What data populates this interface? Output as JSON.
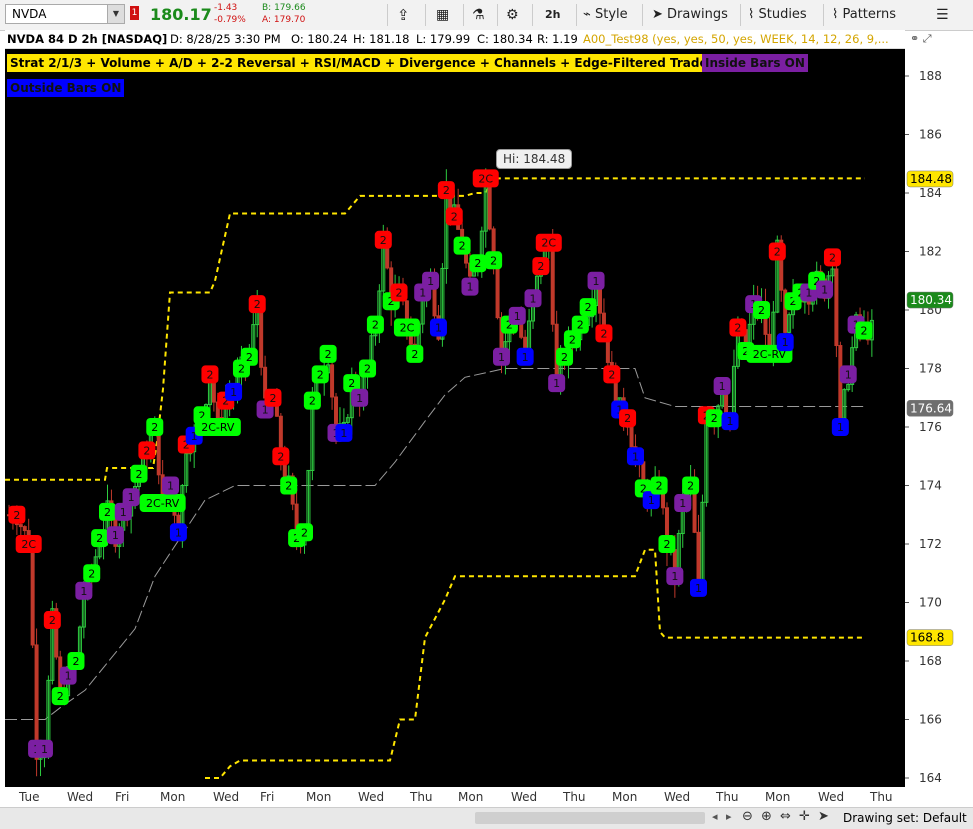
{
  "toolbar": {
    "symbol": "NVDA",
    "flag": "1",
    "last": "180.17",
    "change": "-1.43",
    "change_pct": "-0.79%",
    "bid": "B: 179.66",
    "ask": "A: 179.70",
    "timeframe": "2h",
    "style": "Style",
    "drawings": "Drawings",
    "studies": "Studies",
    "patterns": "Patterns"
  },
  "infobar": {
    "title": "NVDA 84 D 2h [NASDAQ]",
    "date": "D: 8/28/25 3:30 PM",
    "open": "O: 180.24",
    "high": "H: 181.18",
    "low": "L: 179.99",
    "close": "C: 180.34",
    "range": "R: 1.19",
    "study": "A00_Test98 (yes, yes, 50, yes, WEEK, 14, 12, 26, 9,..."
  },
  "labels": {
    "strat": "Strat 2/1/3 + Volume + A/D + 2-2 Reversal + RSI/MACD + Divergence + Channels + Edge-Filtered Trade Bubbles",
    "inside": "Inside Bars ON",
    "outside": "Outside Bars ON",
    "high_bubble": "Hi: 184.48"
  },
  "colors": {
    "up": "#2ecc40",
    "down": "#c0392b",
    "channel": "#ffe600",
    "bubble_green": "#00ff00",
    "bubble_red": "#ff0000",
    "bubble_purple": "#7b1fa2",
    "bubble_blue": "#0000ff"
  },
  "yaxis": {
    "ticks": [
      "188",
      "186",
      "184",
      "182",
      "180",
      "178",
      "176",
      "174",
      "172",
      "170",
      "168",
      "166",
      "164"
    ],
    "tags": [
      {
        "value": 184.48,
        "text": "184.48",
        "kind": "yellow"
      },
      {
        "value": 180.34,
        "text": "180.34",
        "kind": "green"
      },
      {
        "value": 176.64,
        "text": "176.64",
        "kind": "gray"
      },
      {
        "value": 168.8,
        "text": "168.8",
        "kind": "yellow"
      }
    ]
  },
  "xaxis": {
    "labels": [
      "Tue",
      "Wed",
      "Fri",
      "Mon",
      "Wed",
      "Fri",
      "Mon",
      "Wed",
      "Thu",
      "Mon",
      "Wed",
      "Thu",
      "Mon",
      "Wed",
      "Thu",
      "Mon",
      "Wed",
      "Thu"
    ]
  },
  "bottom": {
    "drawing_set": "Drawing set: Default"
  },
  "bubbles": [
    {
      "t": "2",
      "c": "red",
      "i": 2,
      "p": 173.0
    },
    {
      "t": "2C",
      "c": "red",
      "i": 5,
      "p": 172.0
    },
    {
      "t": "1",
      "c": "purple",
      "i": 7,
      "p": 165.0
    },
    {
      "t": "1",
      "c": "purple",
      "i": 9,
      "p": 165.0
    },
    {
      "t": "2",
      "c": "red",
      "i": 11,
      "p": 169.4
    },
    {
      "t": "2",
      "c": "green",
      "i": 13,
      "p": 166.8
    },
    {
      "t": "1",
      "c": "purple",
      "i": 15,
      "p": 167.5
    },
    {
      "t": "2",
      "c": "green",
      "i": 17,
      "p": 168.0
    },
    {
      "t": "1",
      "c": "purple",
      "i": 19,
      "p": 170.4
    },
    {
      "t": "2",
      "c": "green",
      "i": 21,
      "p": 171.0
    },
    {
      "t": "2",
      "c": "green",
      "i": 23,
      "p": 172.2
    },
    {
      "t": "2",
      "c": "green",
      "i": 25,
      "p": 173.1
    },
    {
      "t": "1",
      "c": "purple",
      "i": 27,
      "p": 172.3
    },
    {
      "t": "1",
      "c": "purple",
      "i": 29,
      "p": 173.1
    },
    {
      "t": "1",
      "c": "purple",
      "i": 31,
      "p": 173.6
    },
    {
      "t": "2",
      "c": "green",
      "i": 33,
      "p": 174.4
    },
    {
      "t": "2",
      "c": "red",
      "i": 35,
      "p": 175.2
    },
    {
      "t": "2",
      "c": "green",
      "i": 37,
      "p": 176.0
    },
    {
      "t": "2C-RV",
      "c": "green",
      "i": 39,
      "p": 173.4,
      "wide": true
    },
    {
      "t": "1",
      "c": "purple",
      "i": 41,
      "p": 174.0
    },
    {
      "t": "1",
      "c": "blue",
      "i": 43,
      "p": 172.4
    },
    {
      "t": "2",
      "c": "red",
      "i": 45,
      "p": 175.4
    },
    {
      "t": "1",
      "c": "blue",
      "i": 47,
      "p": 175.7
    },
    {
      "t": "2",
      "c": "green",
      "i": 49,
      "p": 176.4
    },
    {
      "t": "2",
      "c": "red",
      "i": 51,
      "p": 177.8
    },
    {
      "t": "2C-RV",
      "c": "green",
      "i": 53,
      "p": 176.0,
      "wide": true
    },
    {
      "t": "2",
      "c": "red",
      "i": 55,
      "p": 176.9
    },
    {
      "t": "1",
      "c": "blue",
      "i": 57,
      "p": 177.2
    },
    {
      "t": "2",
      "c": "green",
      "i": 59,
      "p": 178.0
    },
    {
      "t": "2",
      "c": "green",
      "i": 61,
      "p": 178.4
    },
    {
      "t": "2",
      "c": "red",
      "i": 63,
      "p": 180.2
    },
    {
      "t": "1",
      "c": "purple",
      "i": 65,
      "p": 176.6
    },
    {
      "t": "2",
      "c": "red",
      "i": 67,
      "p": 177.0
    },
    {
      "t": "2",
      "c": "red",
      "i": 69,
      "p": 175.0
    },
    {
      "t": "2",
      "c": "green",
      "i": 71,
      "p": 174.0
    },
    {
      "t": "2",
      "c": "green",
      "i": 73,
      "p": 172.2
    },
    {
      "t": "2",
      "c": "green",
      "i": 75,
      "p": 172.4
    },
    {
      "t": "2",
      "c": "green",
      "i": 77,
      "p": 176.9
    },
    {
      "t": "2",
      "c": "green",
      "i": 79,
      "p": 177.8
    },
    {
      "t": "2",
      "c": "green",
      "i": 81,
      "p": 178.5
    },
    {
      "t": "1",
      "c": "purple",
      "i": 83,
      "p": 175.8
    },
    {
      "t": "1",
      "c": "blue",
      "i": 85,
      "p": 175.8
    },
    {
      "t": "2",
      "c": "green",
      "i": 87,
      "p": 177.5
    },
    {
      "t": "1",
      "c": "purple",
      "i": 89,
      "p": 177.0
    },
    {
      "t": "2",
      "c": "green",
      "i": 91,
      "p": 178.0
    },
    {
      "t": "2",
      "c": "green",
      "i": 93,
      "p": 179.5
    },
    {
      "t": "2",
      "c": "red",
      "i": 95,
      "p": 182.4
    },
    {
      "t": "2",
      "c": "green",
      "i": 97,
      "p": 180.3
    },
    {
      "t": "2",
      "c": "red",
      "i": 99,
      "p": 180.6
    },
    {
      "t": "2C",
      "c": "green",
      "i": 101,
      "p": 179.4
    },
    {
      "t": "2",
      "c": "green",
      "i": 103,
      "p": 178.5
    },
    {
      "t": "1",
      "c": "purple",
      "i": 105,
      "p": 180.6
    },
    {
      "t": "1",
      "c": "purple",
      "i": 107,
      "p": 181.0
    },
    {
      "t": "1",
      "c": "blue",
      "i": 109,
      "p": 179.4
    },
    {
      "t": "2",
      "c": "red",
      "i": 111,
      "p": 184.1
    },
    {
      "t": "2",
      "c": "red",
      "i": 113,
      "p": 183.2
    },
    {
      "t": "2",
      "c": "green",
      "i": 115,
      "p": 182.2
    },
    {
      "t": "1",
      "c": "purple",
      "i": 117,
      "p": 180.8
    },
    {
      "t": "2",
      "c": "green",
      "i": 119,
      "p": 181.6
    },
    {
      "t": "2C",
      "c": "red",
      "i": 121,
      "p": 184.5
    },
    {
      "t": "2",
      "c": "green",
      "i": 123,
      "p": 181.7
    },
    {
      "t": "1",
      "c": "purple",
      "i": 125,
      "p": 178.4
    },
    {
      "t": "2",
      "c": "green",
      "i": 127,
      "p": 179.5
    },
    {
      "t": "1",
      "c": "purple",
      "i": 129,
      "p": 179.8
    },
    {
      "t": "1",
      "c": "blue",
      "i": 131,
      "p": 178.4
    },
    {
      "t": "1",
      "c": "purple",
      "i": 133,
      "p": 180.4
    },
    {
      "t": "2",
      "c": "red",
      "i": 135,
      "p": 181.5
    },
    {
      "t": "2C",
      "c": "red",
      "i": 137,
      "p": 182.3
    },
    {
      "t": "1",
      "c": "purple",
      "i": 139,
      "p": 177.5
    },
    {
      "t": "2",
      "c": "green",
      "i": 141,
      "p": 178.4
    },
    {
      "t": "2",
      "c": "green",
      "i": 143,
      "p": 179.0
    },
    {
      "t": "2",
      "c": "green",
      "i": 145,
      "p": 179.5
    },
    {
      "t": "2",
      "c": "green",
      "i": 147,
      "p": 180.1
    },
    {
      "t": "1",
      "c": "purple",
      "i": 149,
      "p": 181.0
    },
    {
      "t": "2",
      "c": "red",
      "i": 151,
      "p": 179.2
    },
    {
      "t": "2",
      "c": "red",
      "i": 153,
      "p": 177.8
    },
    {
      "t": "1",
      "c": "blue",
      "i": 155,
      "p": 176.6
    },
    {
      "t": "2",
      "c": "red",
      "i": 157,
      "p": 176.3
    },
    {
      "t": "1",
      "c": "blue",
      "i": 159,
      "p": 175.0
    },
    {
      "t": "2",
      "c": "green",
      "i": 161,
      "p": 173.9
    },
    {
      "t": "1",
      "c": "blue",
      "i": 163,
      "p": 173.5
    },
    {
      "t": "2",
      "c": "green",
      "i": 165,
      "p": 174.0
    },
    {
      "t": "2",
      "c": "green",
      "i": 167,
      "p": 172.0
    },
    {
      "t": "1",
      "c": "purple",
      "i": 169,
      "p": 170.9
    },
    {
      "t": "1",
      "c": "purple",
      "i": 171,
      "p": 173.4
    },
    {
      "t": "2",
      "c": "green",
      "i": 173,
      "p": 174.0
    },
    {
      "t": "1",
      "c": "blue",
      "i": 175,
      "p": 170.5
    },
    {
      "t": "2",
      "c": "red",
      "i": 177,
      "p": 176.4
    },
    {
      "t": "2",
      "c": "green",
      "i": 179,
      "p": 176.3
    },
    {
      "t": "1",
      "c": "purple",
      "i": 181,
      "p": 177.4
    },
    {
      "t": "1",
      "c": "blue",
      "i": 183,
      "p": 176.2
    },
    {
      "t": "2",
      "c": "red",
      "i": 185,
      "p": 179.4
    },
    {
      "t": "2",
      "c": "green",
      "i": 187,
      "p": 178.6
    },
    {
      "t": "1",
      "c": "purple",
      "i": 189,
      "p": 180.2
    },
    {
      "t": "2",
      "c": "green",
      "i": 191,
      "p": 180.0
    },
    {
      "t": "2C-RV",
      "c": "green",
      "i": 193,
      "p": 178.5,
      "wide": true
    },
    {
      "t": "2",
      "c": "red",
      "i": 195,
      "p": 182.0
    },
    {
      "t": "1",
      "c": "blue",
      "i": 197,
      "p": 178.9
    },
    {
      "t": "2",
      "c": "green",
      "i": 199,
      "p": 180.3
    },
    {
      "t": "2",
      "c": "green",
      "i": 201,
      "p": 180.6
    },
    {
      "t": "1",
      "c": "purple",
      "i": 203,
      "p": 180.6
    },
    {
      "t": "2",
      "c": "green",
      "i": 205,
      "p": 181.0
    },
    {
      "t": "1",
      "c": "purple",
      "i": 207,
      "p": 180.7
    },
    {
      "t": "2",
      "c": "red",
      "i": 209,
      "p": 181.8
    },
    {
      "t": "1",
      "c": "blue",
      "i": 211,
      "p": 176.0
    },
    {
      "t": "1",
      "c": "purple",
      "i": 213,
      "p": 177.8
    },
    {
      "t": "1",
      "c": "purple",
      "i": 215,
      "p": 179.5
    },
    {
      "t": "2",
      "c": "green",
      "i": 217,
      "p": 179.3
    }
  ]
}
